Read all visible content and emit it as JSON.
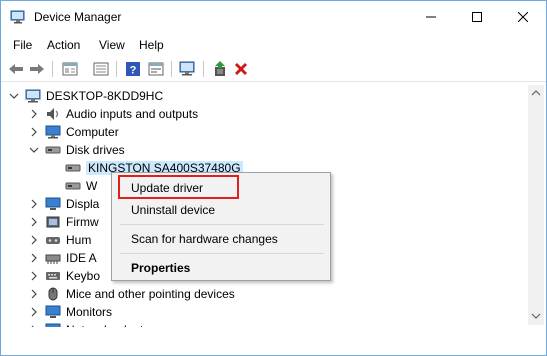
{
  "window": {
    "title": "Device Manager",
    "buttons": {
      "minimize": "minimize",
      "maximize": "maximize",
      "close": "close"
    }
  },
  "menubar": {
    "items": [
      "File",
      "Action",
      "View",
      "Help"
    ]
  },
  "toolbar": {
    "icons": [
      "back-arrow-icon",
      "forward-arrow-icon",
      "properties-icon",
      "list-view-icon",
      "help-icon",
      "device-view-icon",
      "monitor-scan-icon",
      "enable-device-icon",
      "uninstall-x-icon"
    ]
  },
  "tree": {
    "root": "DESKTOP-8KDD9HC",
    "items": [
      {
        "label": "Audio inputs and outputs",
        "icon": "speaker-icon",
        "expanded": false
      },
      {
        "label": "Computer",
        "icon": "computer-icon",
        "expanded": false
      },
      {
        "label": "Disk drives",
        "icon": "disk-icon",
        "expanded": true
      },
      {
        "label": "KINGSTON SA400S37480G",
        "icon": "disk-icon",
        "child": true,
        "selected": true
      },
      {
        "label": "W",
        "icon": "disk-icon",
        "child": true
      },
      {
        "label": "Displa",
        "icon": "monitor-icon",
        "expanded": false
      },
      {
        "label": "Firmw",
        "icon": "firmware-icon",
        "expanded": false
      },
      {
        "label": "Hum",
        "icon": "hid-icon",
        "expanded": false
      },
      {
        "label": "IDE A",
        "icon": "ide-icon",
        "expanded": false
      },
      {
        "label": "Keybo",
        "icon": "keyboard-icon",
        "expanded": false
      },
      {
        "label": "Mice and other pointing devices",
        "icon": "mouse-icon",
        "expanded": false
      },
      {
        "label": "Monitors",
        "icon": "monitor-icon",
        "expanded": false
      },
      {
        "label": "Network adapters",
        "icon": "network-icon",
        "expanded": false
      }
    ]
  },
  "context_menu": {
    "items": [
      "Update driver",
      "Uninstall device",
      "Scan for hardware changes",
      "Properties"
    ]
  },
  "colors": {
    "highlight_border": "#e02020",
    "selection": "#cce8ff",
    "accent": "#0078d7"
  }
}
